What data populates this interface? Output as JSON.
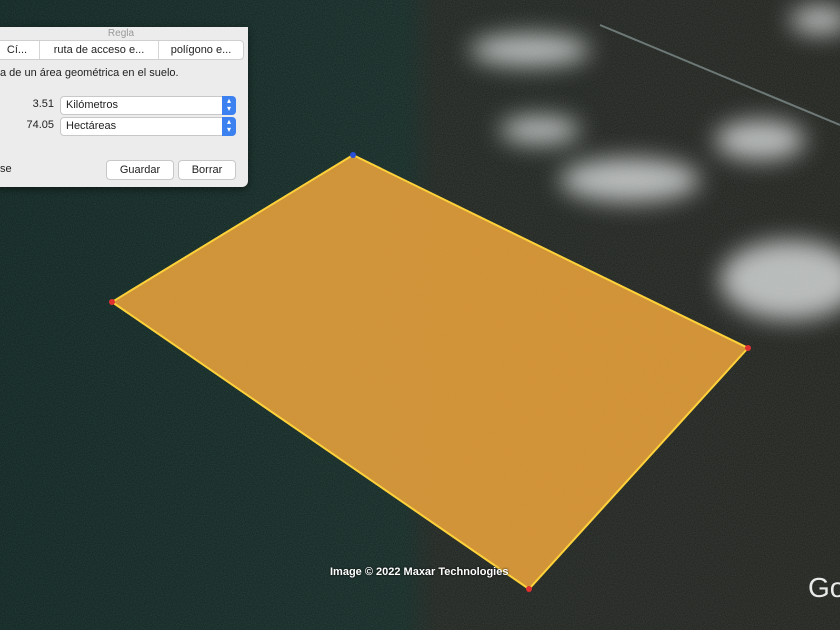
{
  "dialog": {
    "title": "Regla",
    "tabs": [
      {
        "label": "Cí..."
      },
      {
        "label": "ruta de acceso e..."
      },
      {
        "label": "polígono e..."
      }
    ],
    "description": "a de un área geométrica en el suelo.",
    "perimeter": {
      "value": "3.51",
      "unit": "Kilómetros"
    },
    "area": {
      "value": "74.05",
      "unit": "Hectáreas"
    },
    "partial_label": "se",
    "save_label": "Guardar",
    "clear_label": "Borrar"
  },
  "map": {
    "attribution": "Image © 2022 Maxar Technologies",
    "logo_text": "Go",
    "polygon_fill": "#e9a23b",
    "polygon_stroke": "#ffd23a",
    "vertex_color": "#e03030",
    "active_vertex_color": "#2a4fd8"
  }
}
